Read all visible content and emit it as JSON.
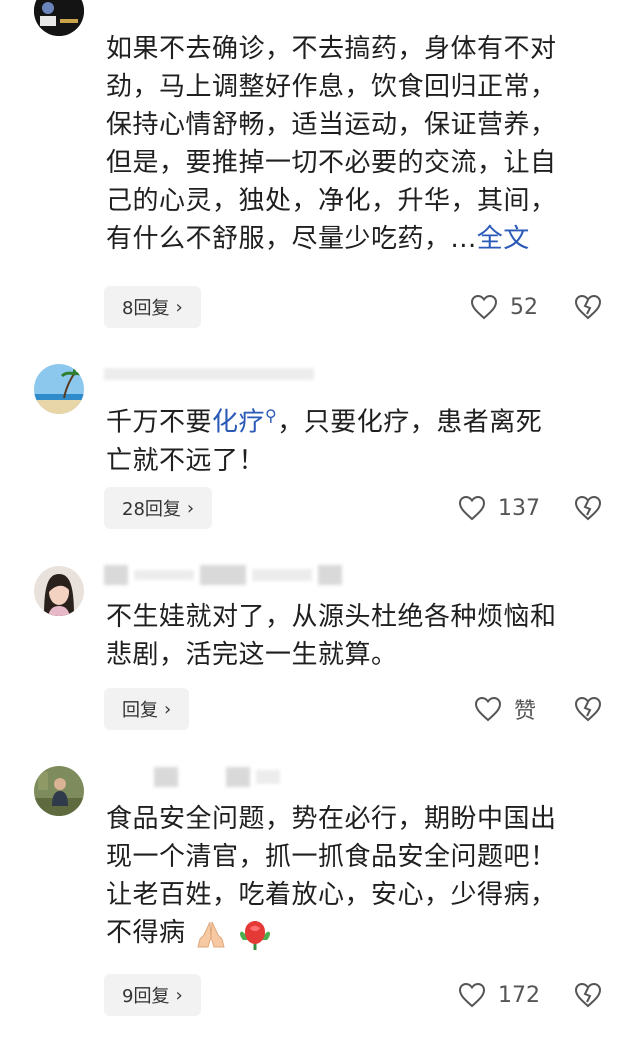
{
  "comments": [
    {
      "body_lines": [
        "如果不去确诊，不去搞药，身体有不对",
        "劲，马上调整好作息，饮食回归正常，",
        "保持心情舒畅，适当运动，保证营养，",
        "但是，要推掉一切不必要的交流，让自",
        "己的心灵，独处，净化，升华，其间，",
        "有什么不舒服，尽量少吃药，..."
      ],
      "more_label": "全文",
      "reply_label": "8回复",
      "like_count": "52"
    },
    {
      "body_prefix": "千万不要",
      "link_text": "化疗",
      "body_rest_line1": "，只要化疗，患者离死",
      "body_line2": "亡就不远了！",
      "reply_label": "28回复",
      "like_count": "137"
    },
    {
      "body_lines": [
        "不生娃就对了，从源头杜绝各种烦恼和",
        "悲剧，活完这一生就算。"
      ],
      "reply_label": "回复",
      "like_count": "赞"
    },
    {
      "body_lines": [
        "食品安全问题，势在必行，期盼中国出",
        "现一个清官，抓一抓食品安全问题吧！",
        "让老百姓，吃着放心，安心，少得病，",
        "不得病"
      ],
      "reply_label": "9回复",
      "like_count": "172"
    }
  ],
  "icons": {
    "like": "heart-outline-icon",
    "dislike": "broken-heart-icon",
    "search_mark": "search-icon",
    "chevron": "chevron-right-icon",
    "emoji_pray": "folded-hands-emoji",
    "emoji_rose": "rose-emoji"
  },
  "colors": {
    "link": "#2a59b7",
    "button_bg": "#f2f2f2",
    "text": "#1f1f1f"
  }
}
